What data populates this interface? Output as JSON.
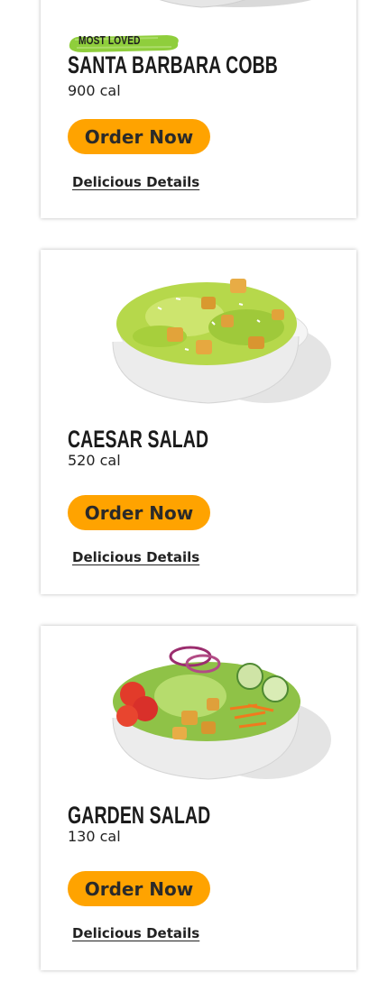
{
  "colors": {
    "accent": "#ffa300",
    "badge_green": "#8fce3c"
  },
  "cards": [
    {
      "badge": "MOST LOVED",
      "title": "SANTA BARBARA COBB",
      "calories": "900 cal",
      "order_label": "Order Now",
      "details_label": "Delicious Details",
      "image": "cobb-salad-image"
    },
    {
      "title": "CAESAR SALAD",
      "calories": "520 cal",
      "order_label": "Order Now",
      "details_label": "Delicious Details",
      "image": "caesar-salad-image"
    },
    {
      "title": "GARDEN SALAD",
      "calories": "130 cal",
      "order_label": "Order Now",
      "details_label": "Delicious Details",
      "image": "garden-salad-image"
    }
  ]
}
